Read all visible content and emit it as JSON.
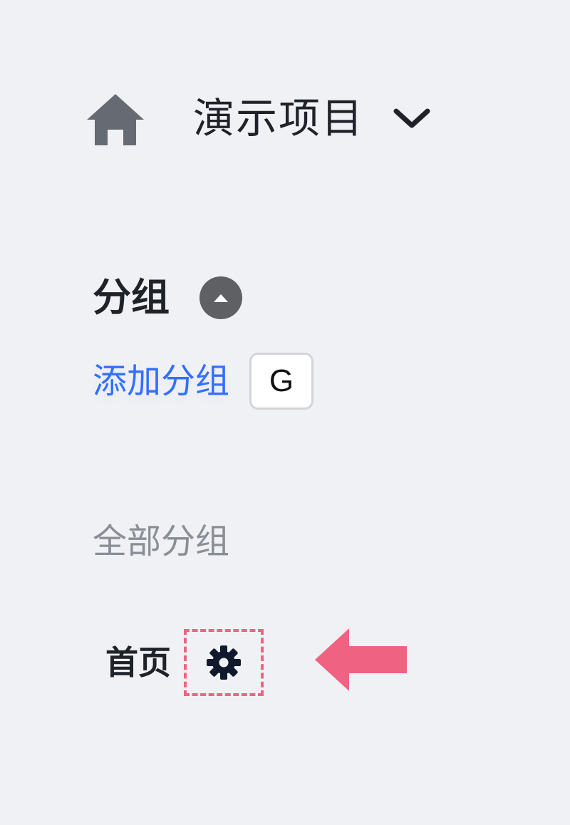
{
  "project": {
    "name": "演示项目",
    "home_icon": "home-icon",
    "dropdown_icon": "chevron-down-icon"
  },
  "groups": {
    "title": "分组",
    "collapse_icon": "caret-up-icon",
    "add_label": "添加分组",
    "shortcut_key": "G",
    "all_label": "全部分组",
    "items": [
      {
        "label": "首页",
        "icon": "gear-icon"
      }
    ]
  },
  "annotation": {
    "pointer_icon": "arrow-left-icon",
    "highlight_color": "#f06282"
  },
  "colors": {
    "background": "#f0f1f5",
    "link": "#3370ff",
    "text": "#1f2329",
    "muted": "#8a8e96"
  }
}
